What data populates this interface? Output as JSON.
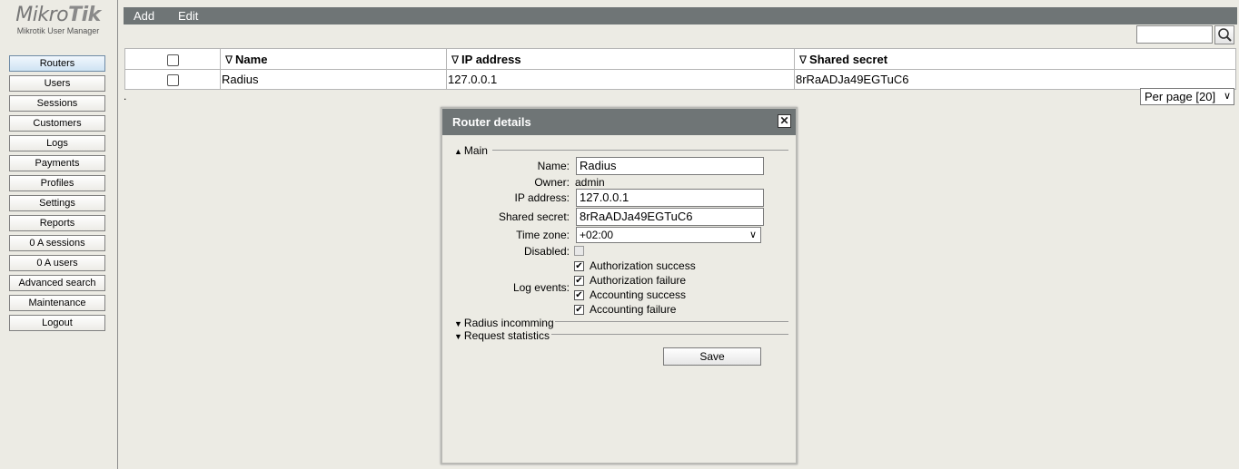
{
  "logo": {
    "brand_light": "Mikro",
    "brand_bold": "Tik",
    "subtitle": "Mikrotik User Manager"
  },
  "sidebar": {
    "items": [
      {
        "label": "Routers",
        "active": true
      },
      {
        "label": "Users"
      },
      {
        "label": "Sessions"
      },
      {
        "label": "Customers"
      },
      {
        "label": "Logs"
      },
      {
        "label": "Payments"
      },
      {
        "label": "Profiles"
      },
      {
        "label": "Settings"
      },
      {
        "label": "Reports"
      },
      {
        "label": "0 A sessions"
      },
      {
        "label": "0 A users"
      },
      {
        "label": "Advanced search"
      },
      {
        "label": "Maintenance"
      },
      {
        "label": "Logout"
      }
    ]
  },
  "toolbar": {
    "add_label": "Add",
    "edit_label": "Edit"
  },
  "search": {
    "value": "",
    "icon": "magnifier-icon"
  },
  "table": {
    "headers": {
      "name": "Name",
      "ip": "IP address",
      "secret": "Shared secret"
    },
    "sort_glyph": "∇",
    "rows": [
      {
        "name": "Radius",
        "ip": "127.0.0.1",
        "secret": "8rRaADJa49EGTuC6"
      }
    ],
    "footer_dot": "."
  },
  "per_page": {
    "value": "Per page [20]"
  },
  "dialog": {
    "title": "Router details",
    "close_glyph": "✕",
    "sections": {
      "main": "Main",
      "radius": "Radius incomming",
      "stats": "Request statistics"
    },
    "fields": {
      "name_label": "Name:",
      "name_value": "Radius",
      "owner_label": "Owner:",
      "owner_value": "admin",
      "ip_label": "IP address:",
      "ip_value": "127.0.0.1",
      "secret_label": "Shared secret:",
      "secret_value": "8rRaADJa49EGTuC6",
      "tz_label": "Time zone:",
      "tz_value": "+02:00",
      "disabled_label": "Disabled:",
      "disabled_checked": false,
      "log_label": "Log events:"
    },
    "log_events": [
      {
        "label": "Authorization success",
        "checked": true
      },
      {
        "label": "Authorization failure",
        "checked": true
      },
      {
        "label": "Accounting success",
        "checked": true
      },
      {
        "label": "Accounting failure",
        "checked": true
      }
    ],
    "check_glyph": "✔",
    "save_label": "Save"
  },
  "colors": {
    "toolbar": "#6f7576",
    "background": "#ecebe4",
    "active_nav": "#cfe3f3"
  }
}
